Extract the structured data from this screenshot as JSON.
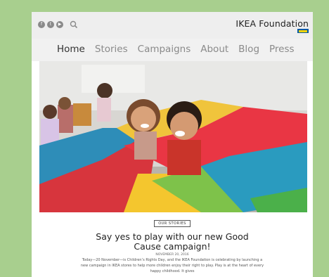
{
  "social_icons": [
    {
      "name": "facebook-icon",
      "glyph": "f"
    },
    {
      "name": "twitter-icon",
      "glyph": "t"
    },
    {
      "name": "youtube-icon",
      "glyph": "▶"
    }
  ],
  "brand": {
    "name": "IKEA Foundation",
    "colors": {
      "blue": "#0058a3",
      "yellow": "#ffd400"
    }
  },
  "nav": {
    "items": [
      {
        "label": "Home",
        "active": true
      },
      {
        "label": "Stories",
        "active": false
      },
      {
        "label": "Campaigns",
        "active": false
      },
      {
        "label": "About",
        "active": false
      },
      {
        "label": "Blog",
        "active": false
      },
      {
        "label": "Press",
        "active": false
      }
    ]
  },
  "article": {
    "tag": "OUR STORIES",
    "headline_line1": "Say yes to play with our new Good",
    "headline_line2": "Cause campaign!",
    "date": "NOVEMBER 20, 2016",
    "body": "Today—20 November—is Children’s Rights Day, and the IKEA Foundation is celebrating by launching a new campaign in IKEA stores to help more children enjoy their right to play. Play is at the heart of every happy childhood. It gives"
  },
  "colors": {
    "background": "#a8cf8e",
    "topbar": "#eeeeee",
    "nav_active": "#333333",
    "nav_inactive": "#8a8a8a"
  }
}
